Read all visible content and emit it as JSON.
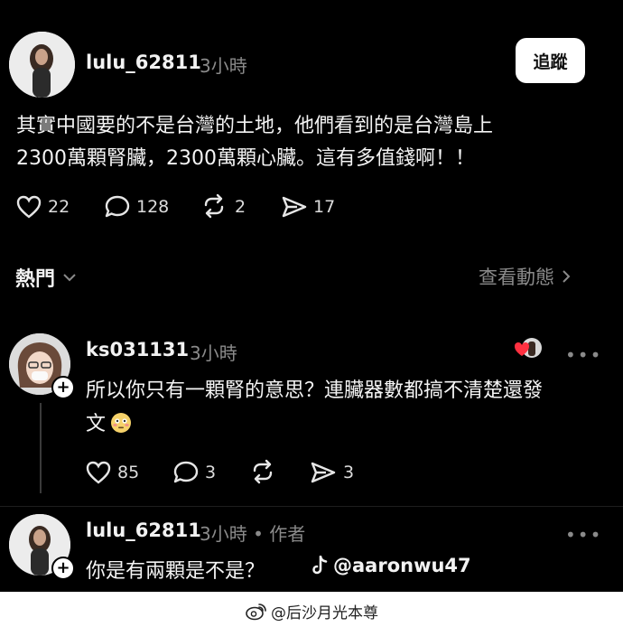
{
  "post": {
    "username": "lulu_62811",
    "time": "3小時",
    "follow_label": "追蹤",
    "text_line1": "其實中國要的不是台灣的土地，他們看到的是台灣島上",
    "text_line2": "2300萬顆腎臟，2300萬顆心臟。這有多值錢啊！！",
    "likes": "22",
    "comments": "128",
    "reposts": "2",
    "shares": "17"
  },
  "sort": {
    "label": "熱門",
    "view_activity": "查看動態"
  },
  "reply1": {
    "username": "ks031131",
    "time": "3小時",
    "text_line1": "所以你只有一顆腎的意思？連臟器數都搞不清楚還發",
    "text_line2": "文",
    "emoji": "😳",
    "likes": "85",
    "comments": "3",
    "shares": "3"
  },
  "reply2": {
    "username": "lulu_62811",
    "time": "3小時",
    "author_tag": "• 作者",
    "text": "你是有兩顆是不是？"
  },
  "watermark": {
    "tiktok": "@aaronwu47",
    "weibo": "@后沙月光本尊"
  },
  "colors": {
    "background": "#000000",
    "text": "#f3f3f3",
    "muted": "#8a8a8a"
  }
}
